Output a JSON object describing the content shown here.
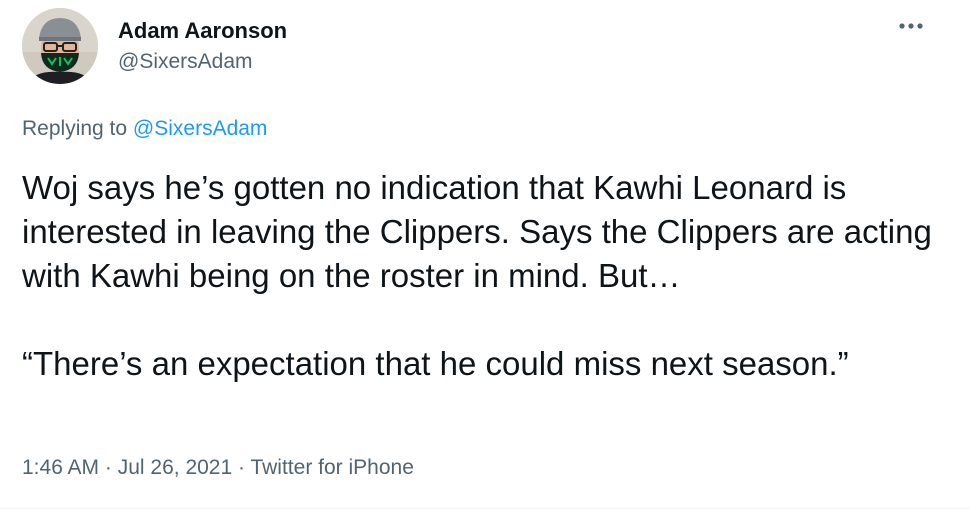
{
  "author": {
    "display_name": "Adam Aaronson",
    "handle": "@SixersAdam"
  },
  "reply_context": {
    "prefix": "Replying to ",
    "mention": "@SixersAdam"
  },
  "tweet": {
    "paragraph_1": "Woj says he’s gotten no indication that Kawhi Leonard is interested in leaving the Clippers. Says the Clippers are acting with Kawhi being on the roster in mind. But…",
    "paragraph_2": "“There’s an expectation that he could miss next season.”"
  },
  "meta": {
    "time": "1:46 AM",
    "separator_1": " · ",
    "date": "Jul 26, 2021",
    "separator_2": " · ",
    "source": "Twitter for iPhone"
  },
  "icons": {
    "more": "more-horizontal-icon",
    "avatar_mask_color": "#0d2a1c"
  },
  "colors": {
    "text_primary": "#0f1419",
    "text_secondary": "#536471",
    "link": "#1d9bf0"
  }
}
